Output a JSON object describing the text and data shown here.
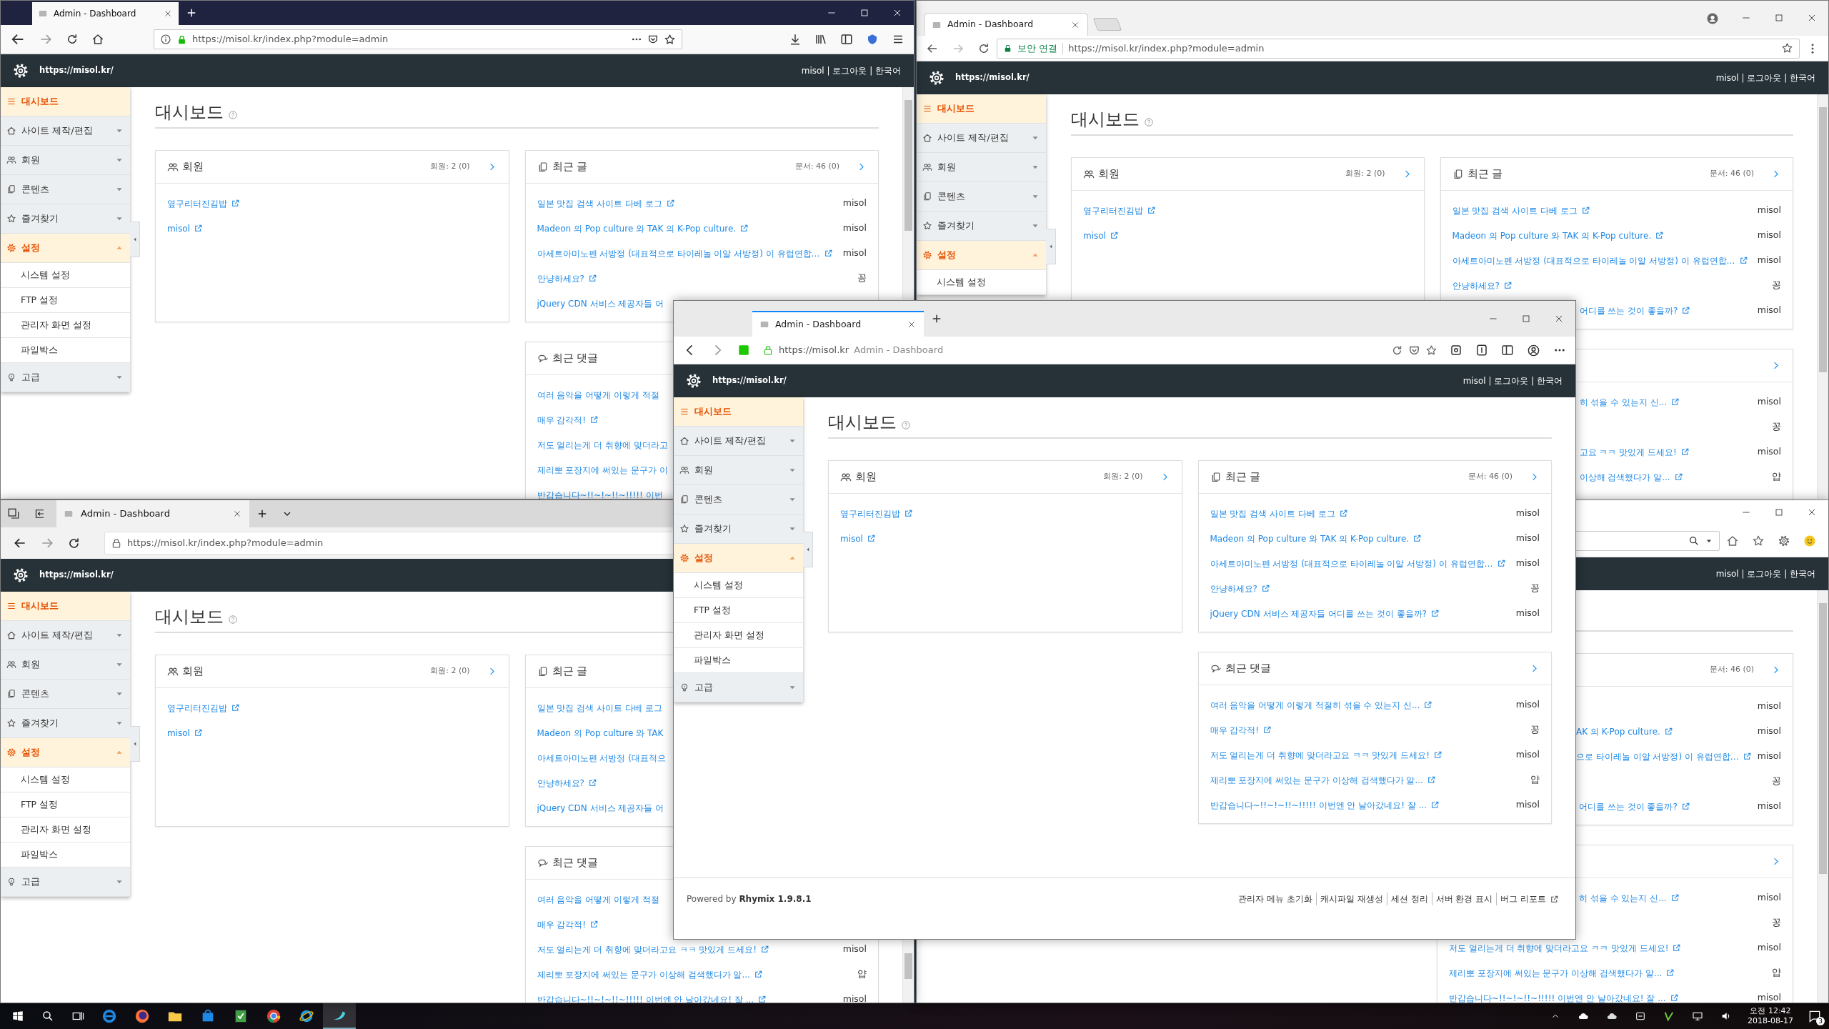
{
  "desktop": {
    "windows": [
      {
        "kind": "firefox",
        "tab_title": "Admin - Dashboard",
        "url": "https://misol.kr/index.php?module=admin",
        "site_url": "https://misol.kr/",
        "user_menu": "misol | 로그아웃 | 한국어",
        "sidebar": [
          {
            "label": "대시보드",
            "selected": true
          },
          {
            "label": "사이트 제작/편집",
            "selected": false,
            "expanded": false
          },
          {
            "label": "회원",
            "selected": false,
            "expanded": false
          },
          {
            "label": "콘텐츠",
            "selected": false,
            "expanded": false
          },
          {
            "label": "즐겨찾기",
            "selected": false,
            "expanded": false
          },
          {
            "label": "설정",
            "selected": true,
            "expanded": true,
            "children": [
              {
                "label": "시스템 설정",
                "selected": false
              },
              {
                "label": "FTP 설정",
                "selected": false
              },
              {
                "label": "관리자 화면 설정",
                "selected": false
              },
              {
                "label": "파일박스",
                "selected": false
              }
            ]
          },
          {
            "label": "고급",
            "selected": false,
            "expanded": false
          }
        ],
        "page_title": "대시보드",
        "members": {
          "title": "회원",
          "count": "회원: 2 (0)",
          "items": [
            {
              "title": "옆구리터진김밥"
            },
            {
              "title": "misol"
            }
          ]
        },
        "posts": {
          "title": "최근 글",
          "count": "문서: 46 (0)",
          "items": [
            {
              "title": "일본 맛집 검색 사이트 다베 로그",
              "author": "misol"
            },
            {
              "title": "Madeon 의 Pop culture 와 TAK 의 K-Pop culture.",
              "author": "misol"
            },
            {
              "title": "아세트아미노펜 서방정 (대표적으로 타이레놀 이알 서방정) 이 유럽연합…",
              "author": "misol"
            },
            {
              "title": "안냥하세요?",
              "author": "꽁"
            },
            {
              "title": "jQuery CDN 서비스 제공자들 어",
              "cut_end": true
            }
          ]
        },
        "comments": {
          "title": "최근 댓글",
          "items": [
            {
              "title": "여러 음악을 어떻게 이렇게 적절",
              "cut_end": true
            },
            {
              "title": "매우 감각적!"
            },
            {
              "title": "저도 얼리는게 더 취향에 맞더라고",
              "cut_end": true
            },
            {
              "title": "제리뽀 포장지에 써있는 문구가 이",
              "cut_end": true
            },
            {
              "title": "반갑습니다~!!~!~!!~!!!!! 이번",
              "cut_end": true
            }
          ]
        }
      },
      {
        "kind": "chrome",
        "tab_title": "Admin - Dashboard",
        "security_label": "보안 연결",
        "url": "https://misol.kr/index.php?module=admin",
        "site_url": "https://misol.kr/",
        "user_menu": "misol | 로그아웃 | 한국어",
        "sidebar": [
          {
            "label": "대시보드",
            "selected": true
          },
          {
            "label": "사이트 제작/편집",
            "selected": false,
            "expanded": false
          },
          {
            "label": "회원",
            "selected": false,
            "expanded": false
          },
          {
            "label": "콘텐츠",
            "selected": false,
            "expanded": false
          },
          {
            "label": "즐겨찾기",
            "selected": false,
            "expanded": false
          },
          {
            "label": "설정",
            "selected": true,
            "expanded": true,
            "children": [
              {
                "label": "시스템 설정",
                "selected": false
              }
            ]
          }
        ],
        "page_title": "대시보드",
        "members": {
          "title": "회원",
          "count": "회원: 2 (0)",
          "items": [
            {
              "title": "옆구리터진김밥"
            },
            {
              "title": "misol"
            }
          ]
        },
        "posts": {
          "title": "최근 글",
          "count": "문서: 46 (0)",
          "items": [
            {
              "title": "일본 맛집 검색 사이트 다베 로그",
              "author": "misol"
            },
            {
              "title": "Madeon 의 Pop culture 와 TAK 의 K-Pop culture.",
              "author": "misol"
            },
            {
              "title": "아세트아미노펜 서방정 (대표적으로 타이레놀 이알 서방정) 이 유럽연합…",
              "author": "misol"
            },
            {
              "title": "안냥하세요?",
              "author": "꽁"
            },
            {
              "title": "어디를 쓰는 것이 좋을까?",
              "author": "misol",
              "cut_start": true
            }
          ]
        },
        "comments": {
          "items": [
            {
              "title": "히 섞을 수 있는지 신...",
              "author": "misol",
              "cut_start": true
            },
            {
              "author": "꽁"
            },
            {
              "title": "고요 ㅋㅋ 맛있게 드세요!",
              "author": "misol",
              "cut_start": true
            },
            {
              "title": "이상해 검색했다가 알...",
              "author": "얍",
              "cut_start": true
            }
          ]
        }
      },
      {
        "kind": "firefox_light",
        "tab_title": "Admin - Dashboard",
        "url": "https://misol.kr",
        "url_title": "Admin - Dashboard",
        "site_url": "https://misol.kr/",
        "user_menu": "misol | 로그아웃 | 한국어",
        "sidebar": [
          {
            "label": "대시보드",
            "selected": true
          },
          {
            "label": "사이트 제작/편집",
            "selected": false,
            "expanded": false
          },
          {
            "label": "회원",
            "selected": false,
            "expanded": false
          },
          {
            "label": "콘텐츠",
            "selected": false,
            "expanded": false
          },
          {
            "label": "즐겨찾기",
            "selected": false,
            "expanded": false
          },
          {
            "label": "설정",
            "selected": true,
            "expanded": true,
            "children": [
              {
                "label": "시스템 설정",
                "selected": false
              },
              {
                "label": "FTP 설정",
                "selected": false
              },
              {
                "label": "관리자 화면 설정",
                "selected": false
              },
              {
                "label": "파일박스",
                "selected": false
              }
            ]
          },
          {
            "label": "고급",
            "selected": false,
            "expanded": false
          }
        ],
        "page_title": "대시보드",
        "members": {
          "title": "회원",
          "count": "회원: 2 (0)",
          "items": [
            {
              "title": "옆구리터진김밥"
            },
            {
              "title": "misol"
            }
          ]
        },
        "posts": {
          "title": "최근 글",
          "count": "문서: 46 (0)",
          "items": [
            {
              "title": "일본 맛집 검색 사이트 다베 로그",
              "author": "misol"
            },
            {
              "title": "Madeon 의 Pop culture 와 TAK 의 K-Pop culture.",
              "author": "misol"
            },
            {
              "title": "아세트아미노펜 서방정 (대표적으로 타이레놀 이알 서방정) 이 유럽연합…",
              "author": "misol"
            },
            {
              "title": "안냥하세요?",
              "author": "꽁"
            },
            {
              "title": "jQuery CDN 서비스 제공자들 어디를 쓰는 것이 좋을까?",
              "author": "misol"
            }
          ]
        },
        "comments": {
          "title": "최근 댓글",
          "items": [
            {
              "title": "여러 음악을 어떻게 이렇게 적절히 섞을 수 있는지 신...",
              "author": "misol"
            },
            {
              "title": "매우 감각적!",
              "author": "꽁"
            },
            {
              "title": "저도 얼리는게 더 취향에 맞더라고요 ㅋㅋ 맛있게 드세요!",
              "author": "misol"
            },
            {
              "title": "제리뽀 포장지에 써있는 문구가 이상해 검색했다가 알...",
              "author": "얍"
            },
            {
              "title": "반갑습니다~!!~!~!!~!!!!! 이번엔 안 날아갔네요! 잘 ...",
              "author": "misol"
            }
          ]
        },
        "footer": {
          "powered": "Powered by **Rhymix 1.9.8.1**",
          "links": [
            "관리자 메뉴 초기화",
            "캐시파일 재생성",
            "세션 정리",
            "서버 환경 표시",
            "버그 리포트"
          ]
        }
      },
      {
        "kind": "edge",
        "tab_title": "Admin - Dashboard",
        "url": "https://misol.kr/index.php?module=admin",
        "site_url": "https://misol.kr/",
        "sidebar": [
          {
            "label": "대시보드",
            "selected": true
          },
          {
            "label": "사이트 제작/편집",
            "selected": false,
            "expanded": false
          },
          {
            "label": "회원",
            "selected": false,
            "expanded": false
          },
          {
            "label": "콘텐츠",
            "selected": false,
            "expanded": false
          },
          {
            "label": "즐겨찾기",
            "selected": false,
            "expanded": false
          },
          {
            "label": "설정",
            "selected": true,
            "expanded": true,
            "children": [
              {
                "label": "시스템 설정",
                "selected": false
              },
              {
                "label": "FTP 설정",
                "selected": false
              },
              {
                "label": "관리자 화면 설정",
                "selected": false
              },
              {
                "label": "파일박스",
                "selected": false
              }
            ]
          },
          {
            "label": "고급",
            "selected": false,
            "expanded": false
          }
        ],
        "page_title": "대시보드",
        "members": {
          "title": "회원",
          "count": "회원: 2 (0)",
          "items": [
            {
              "title": "옆구리터진김밥"
            },
            {
              "title": "misol"
            }
          ]
        },
        "posts": {
          "title": "최근 글",
          "items": [
            {
              "title": "일본 맛집 검색 사이트 다베 로그",
              "cut_end": true
            },
            {
              "title": "Madeon 의 Pop culture 와 TAK",
              "cut_end": true
            },
            {
              "title": "아세트아미노펜 서방정 (대표적으",
              "cut_end": true
            },
            {
              "title": "안냥하세요?"
            },
            {
              "title": "jQuery CDN 서비스 제공자들 어",
              "cut_end": true
            }
          ]
        },
        "comments": {
          "title": "최근 댓글",
          "items": [
            {
              "title": "여러 음악을 어떻게 이렇게 적절",
              "cut_end": true
            },
            {
              "title": "매우 감각적!"
            },
            {
              "title": "저도 얼리는게 더 취향에 맞더라고요 ㅋㅋ 맛있게 드세요!",
              "author": "misol"
            },
            {
              "title": "제리뽀 포장지에 써있는 문구가 이상해 검색했다가 알...",
              "author": "얍"
            },
            {
              "title": "반갑습니다~!!~!~!!~!!!!! 이번엔 안 날아갔네요! 잘 ...",
              "author": "misol"
            }
          ]
        }
      },
      {
        "kind": "ie",
        "user_menu": "misol | 로그아웃 | 한국어",
        "posts": {
          "count": "문서: 46 (0)",
          "items": [
            {
              "author": "misol"
            },
            {
              "title": "AK 의 K-Pop culture.",
              "author": "misol",
              "cut_start": true
            },
            {
              "title": "으로 타이레놀 이알 서방정) 이 유럽연합…",
              "author": "misol",
              "cut_start": true
            },
            {
              "author": "꽁"
            },
            {
              "title": "어디를 쓰는 것이 좋을까?",
              "author": "misol",
              "cut_start": true
            }
          ]
        },
        "comments": {
          "items": [
            {
              "title": "히 섞을 수 있는지 신...",
              "author": "misol",
              "cut_start": true
            },
            {
              "author": "꽁"
            },
            {
              "title": "저도 얼리는게 더 취향에 맞더라고요 ㅋㅋ 맛있게 드세요!",
              "author": "misol"
            },
            {
              "title": "제리뽀 포장지에 써있는 문구가 이상해 검색했다가 알...",
              "author": "얍"
            },
            {
              "title": "반갑습니다~!!~!~!!~!!!!! 이번엔 안 날아갔네요! 잘 ...",
              "author": "misol"
            }
          ]
        }
      }
    ]
  },
  "taskbar": {
    "time": "오전 12:42",
    "date": "2018-08-17",
    "notifications": "3"
  }
}
